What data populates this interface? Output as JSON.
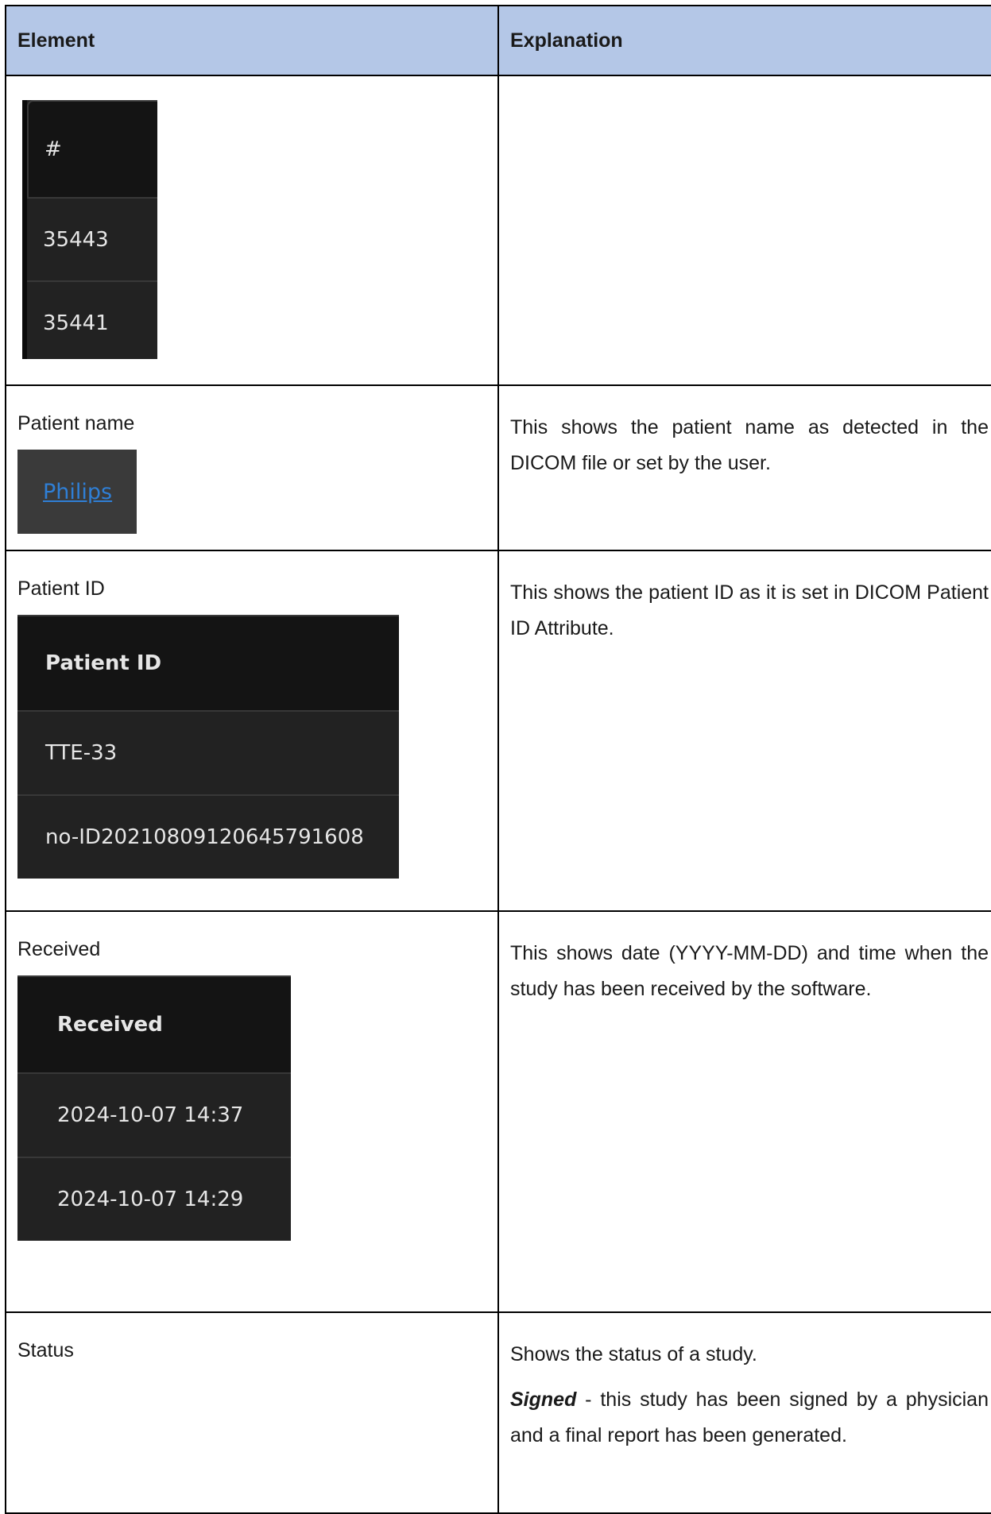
{
  "table": {
    "headers": {
      "element": "Element",
      "explanation": "Explanation"
    },
    "rows": [
      {
        "element_label": "",
        "ui": {
          "header": "#",
          "values": [
            "35443",
            "35441"
          ]
        },
        "explanation": ""
      },
      {
        "element_label": "Patient name",
        "ui": {
          "link": "Philips"
        },
        "explanation": "This shows the patient name as detected in the DICOM file or set by the user."
      },
      {
        "element_label": "Patient ID",
        "ui": {
          "header": "Patient ID",
          "values": [
            "TTE-33",
            "no-ID20210809120645791608"
          ]
        },
        "explanation": "This shows the patient ID as it is set in DICOM Patient ID Attribute."
      },
      {
        "element_label": "Received",
        "ui": {
          "header": "Received",
          "values": [
            "2024-10-07 14:37",
            "2024-10-07 14:29"
          ]
        },
        "explanation": "This shows date (YYYY-MM-DD) and time when the study has been received by the software."
      },
      {
        "element_label": "Status",
        "explanation": "Shows the status of a study.",
        "status_term": "Signed",
        "status_desc": " - this study has been signed by a physician and a final report has been generated."
      }
    ]
  }
}
